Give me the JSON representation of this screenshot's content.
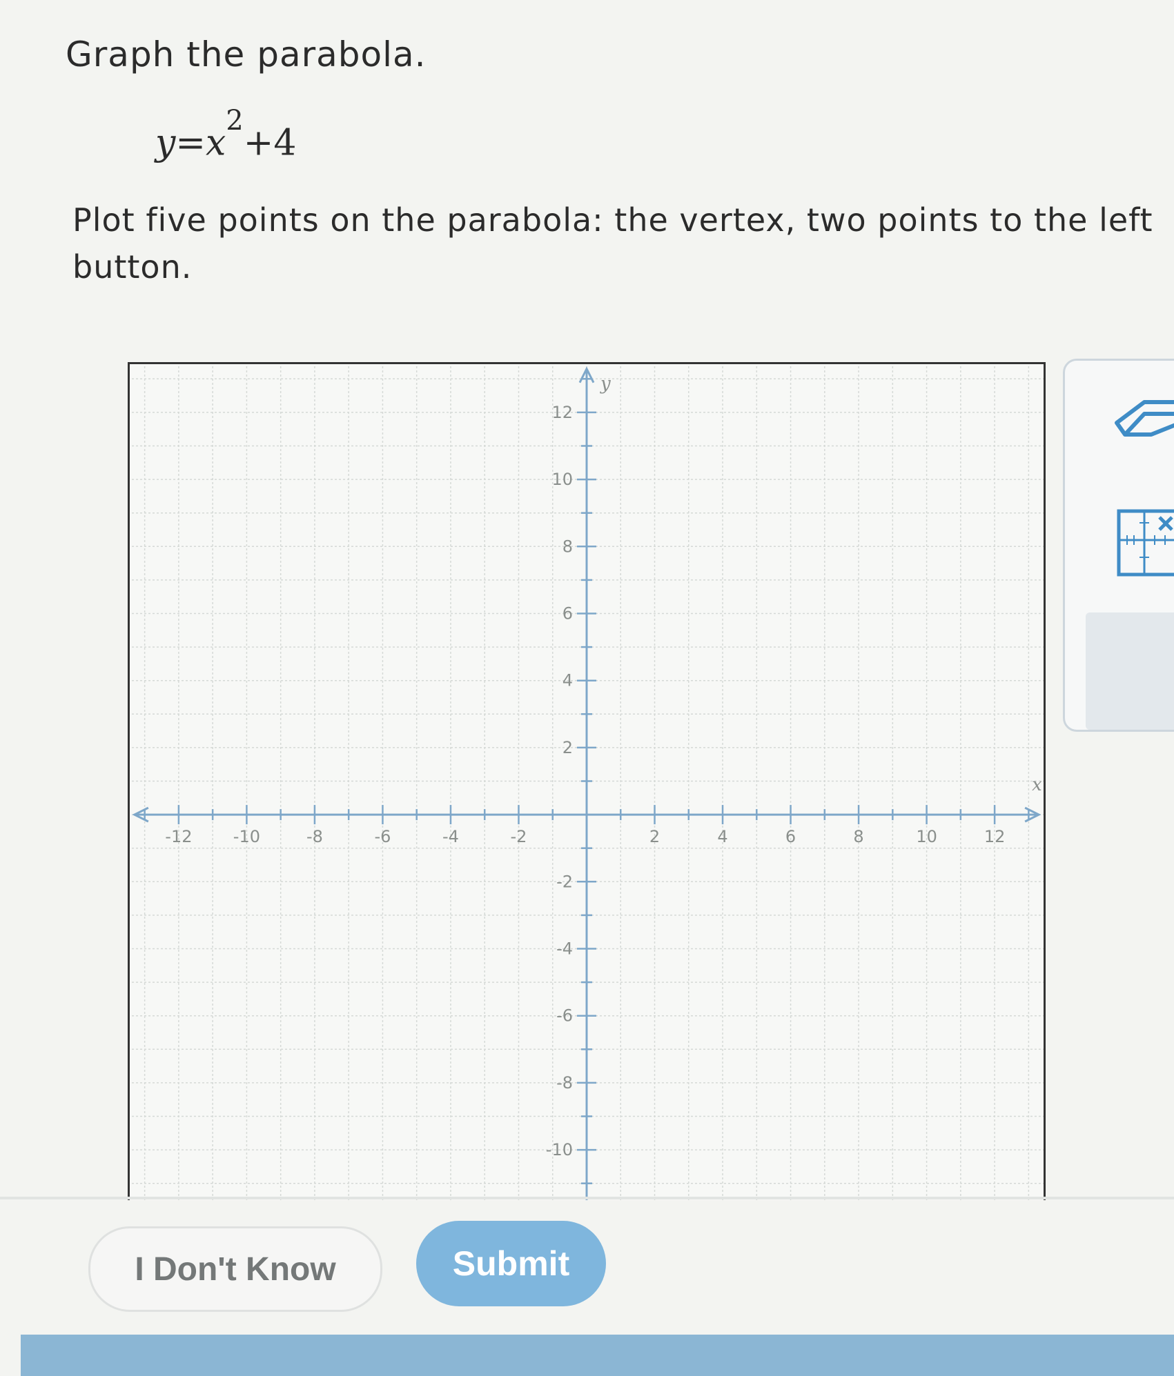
{
  "question": {
    "title": "Graph the parabola.",
    "equation": {
      "lhs": "y",
      "equals": "=",
      "base": "x",
      "exponent": "2",
      "rest": "+4"
    },
    "instructions": [
      "Plot five points on the parabola: the vertex, two points to the left",
      "button."
    ]
  },
  "graph": {
    "x_axis_label": "x",
    "y_axis_label": "y",
    "x_range": [
      -13.5,
      13.5
    ],
    "y_range": [
      -11.5,
      13.5
    ],
    "x_ticks": [
      -12,
      -10,
      -8,
      -6,
      -4,
      -2,
      2,
      4,
      6,
      8,
      10,
      12
    ],
    "y_ticks": [
      12,
      10,
      8,
      6,
      4,
      2,
      -2,
      -4,
      -6,
      -8,
      -10
    ],
    "grid": true,
    "colors": {
      "axis": "#7ea7c9",
      "grid": "#d5d9d6",
      "border": "#333333"
    }
  },
  "tools": {
    "eraser": "eraser-icon",
    "delete": "delete-point-icon",
    "accent": "#3f8cc6"
  },
  "buttons": {
    "dont_know": "I Don't Know",
    "submit": "Submit"
  }
}
